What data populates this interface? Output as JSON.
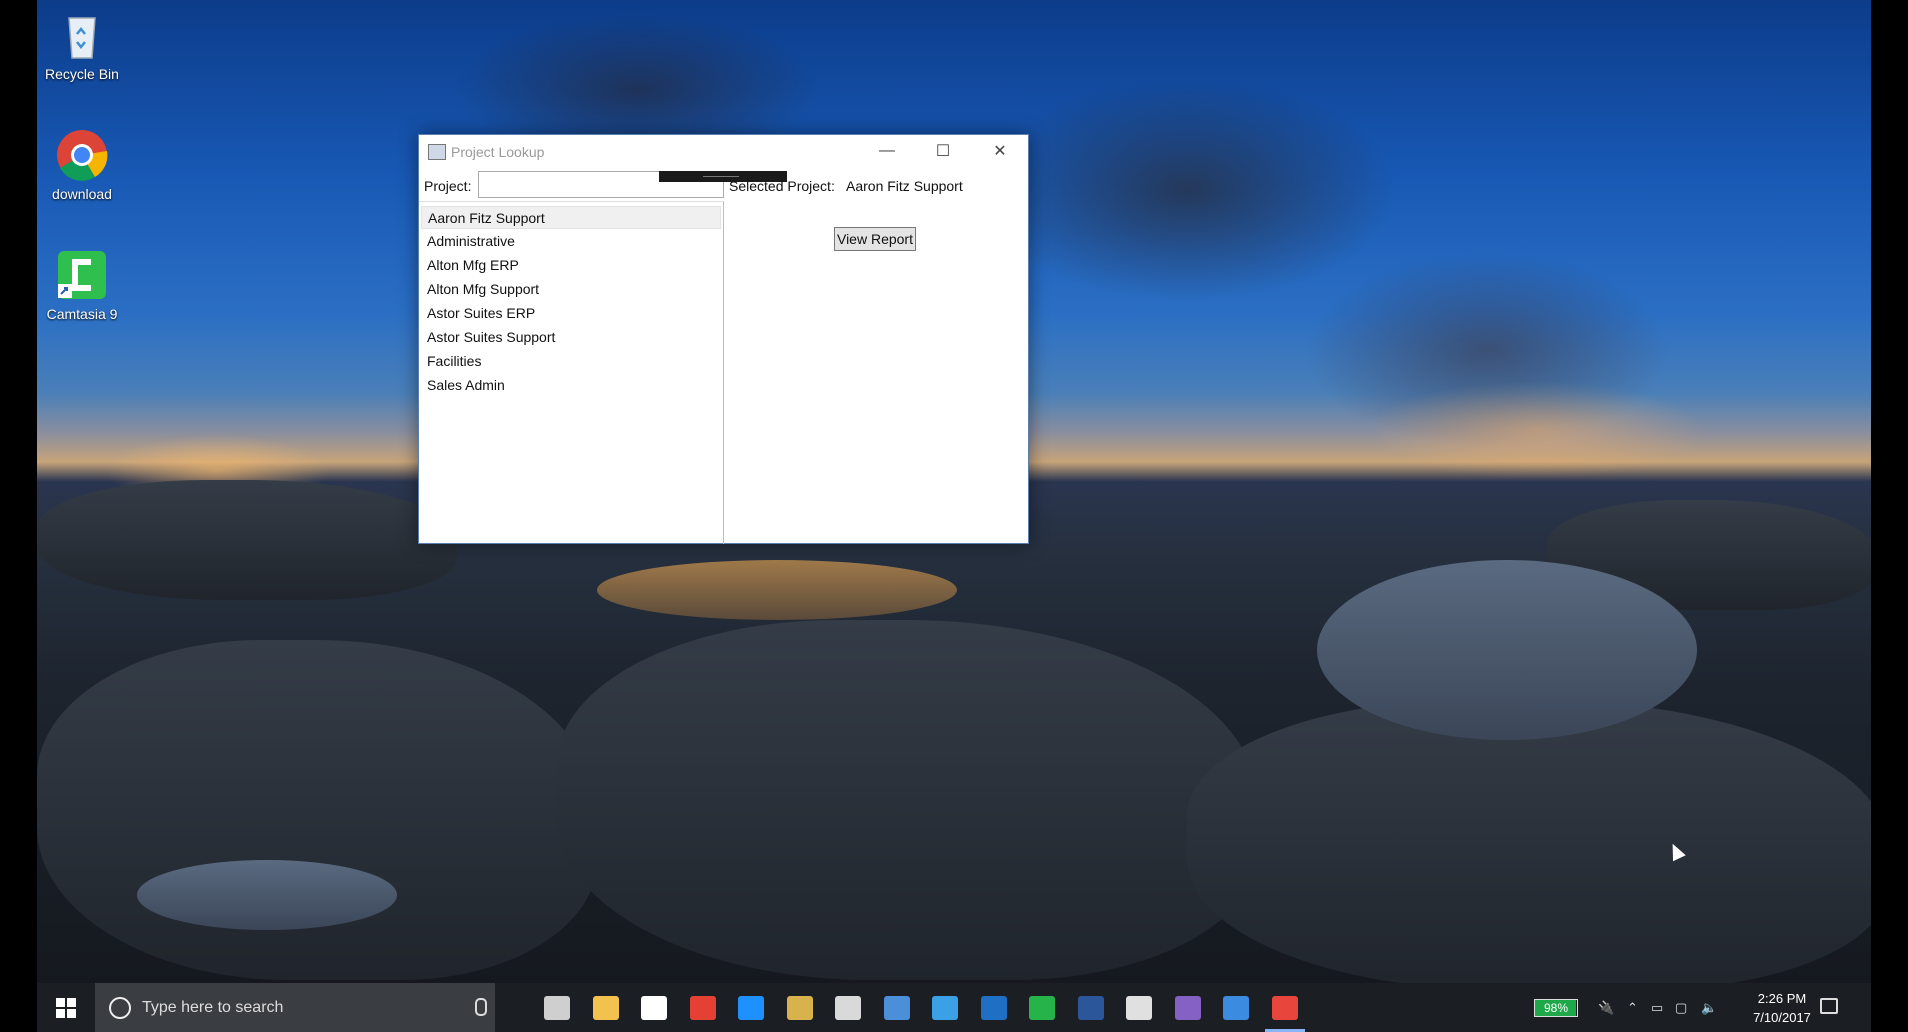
{
  "desktop": {
    "icons": [
      {
        "label": "Recycle Bin",
        "icon": "recycle-bin-icon"
      },
      {
        "label": "download",
        "icon": "chrome-icon"
      },
      {
        "label": "Camtasia 9",
        "icon": "camtasia-icon"
      }
    ]
  },
  "window": {
    "title": "Project Lookup",
    "controls": {
      "minimize": "—",
      "maximize": "☐",
      "close": "✕"
    },
    "project_label": "Project:",
    "project_value": "",
    "projects": [
      "Aaron Fitz Support",
      "Administrative",
      "Alton Mfg ERP",
      "Alton Mfg Support",
      "Astor Suites ERP",
      "Astor Suites Support",
      "Facilities",
      "Sales Admin"
    ],
    "selected_index": 0,
    "selected_label": "Selected Project:",
    "selected_value": "Aaron Fitz Support",
    "view_report_label": "View Report"
  },
  "taskbar": {
    "search_placeholder": "Type here to search",
    "pinned": [
      {
        "name": "task-view-icon",
        "color": "#cfcfcf"
      },
      {
        "name": "file-explorer-icon",
        "color": "#f2c14e"
      },
      {
        "name": "mail-icon",
        "color": "#ffffff"
      },
      {
        "name": "chrome-icon",
        "color": "#e44134"
      },
      {
        "name": "edge-icon",
        "color": "#1e90ff"
      },
      {
        "name": "app-yellow-icon",
        "color": "#d8b24a"
      },
      {
        "name": "paint-icon",
        "color": "#d9d9d9"
      },
      {
        "name": "power-bi-icon",
        "color": "#4a8fd8"
      },
      {
        "name": "sway-icon",
        "color": "#3ba0e6"
      },
      {
        "name": "outlook-icon",
        "color": "#1f6fc5"
      },
      {
        "name": "camtasia-icon",
        "color": "#26b34a"
      },
      {
        "name": "word-icon",
        "color": "#2b579a"
      },
      {
        "name": "calendar-icon",
        "color": "#e0e0e0"
      },
      {
        "name": "visual-studio-icon",
        "color": "#8661c5"
      },
      {
        "name": "app-window-icon",
        "color": "#3b8be0"
      },
      {
        "name": "camtasia-recorder-icon",
        "color": "#e8453c"
      }
    ],
    "battery": {
      "percent_label": "98%",
      "level": 0.98,
      "color": "#1ea84a"
    },
    "time": "2:26 PM",
    "date": "7/10/2017"
  }
}
